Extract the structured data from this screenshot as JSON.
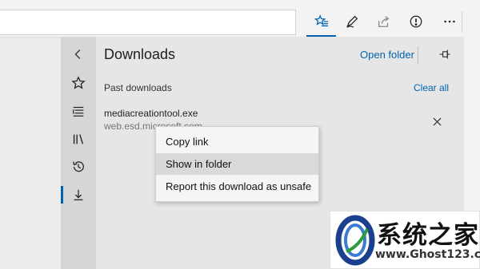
{
  "toolbar": {
    "icons": [
      "favorites-star-icon",
      "pen-icon",
      "share-icon",
      "feedback-icon",
      "more-icon"
    ]
  },
  "rail": {
    "icons": [
      "back-chevron-icon",
      "favorites-star-icon",
      "reading-list-icon",
      "books-icon",
      "history-icon",
      "downloads-icon"
    ],
    "active": "downloads"
  },
  "downloads": {
    "title": "Downloads",
    "open_folder": "Open folder",
    "pin_icon": "pin-icon",
    "section_label": "Past downloads",
    "clear_all": "Clear all",
    "items": [
      {
        "name": "mediacreationtool.exe",
        "source": "web.esd.microsoft.com"
      }
    ]
  },
  "context_menu": {
    "items": [
      "Copy link",
      "Show in folder",
      "Report this download as unsafe"
    ],
    "highlighted": "Show in folder"
  },
  "watermark": {
    "title": "系统之家",
    "url": "www.Ghost123.com"
  },
  "colors": {
    "accent": "#0063b1",
    "panel_bg": "#e6e6e6",
    "rail_bg": "#d6d6d6"
  }
}
